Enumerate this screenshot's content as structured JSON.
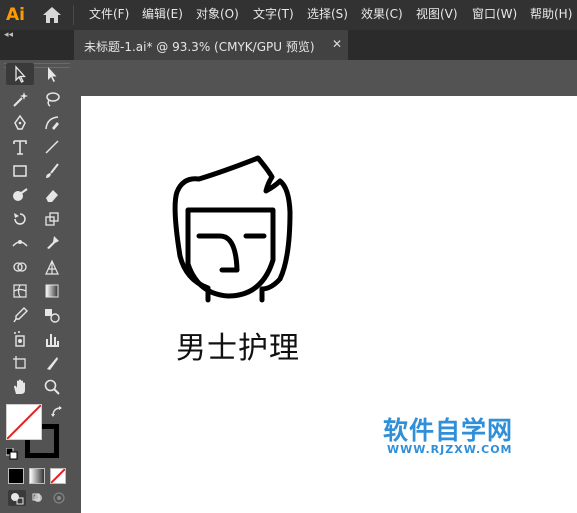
{
  "app": {
    "logo": "Ai"
  },
  "menu": [
    "文件(F)",
    "编辑(E)",
    "对象(O)",
    "文字(T)",
    "选择(S)",
    "效果(C)",
    "视图(V)",
    "窗口(W)",
    "帮助(H)"
  ],
  "panel_toggle": "◂◂",
  "tab": {
    "title": "未标题-1.ai* @ 93.3% (CMYK/GPU 预览)",
    "close": "✕"
  },
  "artwork": {
    "text": "男士护理"
  },
  "watermark": {
    "main": "软件自学网",
    "url": "WWW.RJZXW.COM"
  },
  "colors": {
    "accent": "#ff9a00",
    "watermark": "#2f8fd9",
    "stroke_swatch": "#000000",
    "fill_swatch": "#ffffff",
    "none_slash": "#e02020"
  },
  "tools": [
    "selection-tool",
    "direct-selection-tool",
    "magic-wand-tool",
    "lasso-tool",
    "pen-tool",
    "curvature-tool",
    "type-tool",
    "line-segment-tool",
    "rectangle-tool",
    "paintbrush-tool",
    "shaper-tool",
    "eraser-tool",
    "rotate-tool",
    "scale-tool",
    "width-tool",
    "puppet-warp-tool",
    "shape-builder-tool",
    "perspective-grid-tool",
    "mesh-tool",
    "gradient-tool",
    "eyedropper-tool",
    "blend-tool",
    "symbol-sprayer-tool",
    "column-graph-tool",
    "artboard-tool",
    "slice-tool",
    "hand-tool",
    "zoom-tool"
  ]
}
